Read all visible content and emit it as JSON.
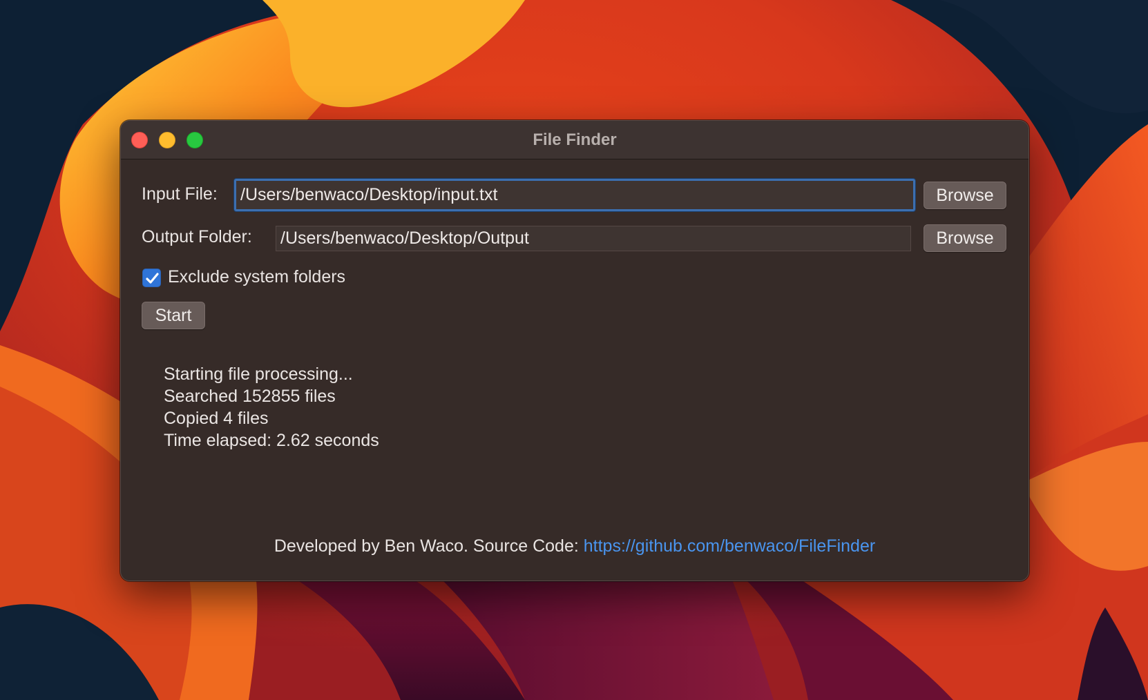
{
  "window": {
    "title": "File Finder"
  },
  "input_file": {
    "label": "Input File:",
    "value": "/Users/benwaco/Desktop/input.txt",
    "browse_label": "Browse"
  },
  "output_folder": {
    "label": "Output Folder:",
    "value": "/Users/benwaco/Desktop/Output",
    "browse_label": "Browse"
  },
  "options": {
    "exclude_system_label": "Exclude system folders",
    "exclude_system_checked": true
  },
  "actions": {
    "start_label": "Start"
  },
  "log": {
    "lines": [
      "Starting file processing...",
      "Searched 152855 files",
      "Copied 4 files",
      "Time elapsed: 2.62 seconds"
    ]
  },
  "footer": {
    "text": "Developed by Ben Waco. Source Code: ",
    "link": "https://github.com/benwaco/FileFinder"
  },
  "colors": {
    "window_bg": "#362b28",
    "accent": "#2f74d8",
    "link": "#4a95ef"
  }
}
